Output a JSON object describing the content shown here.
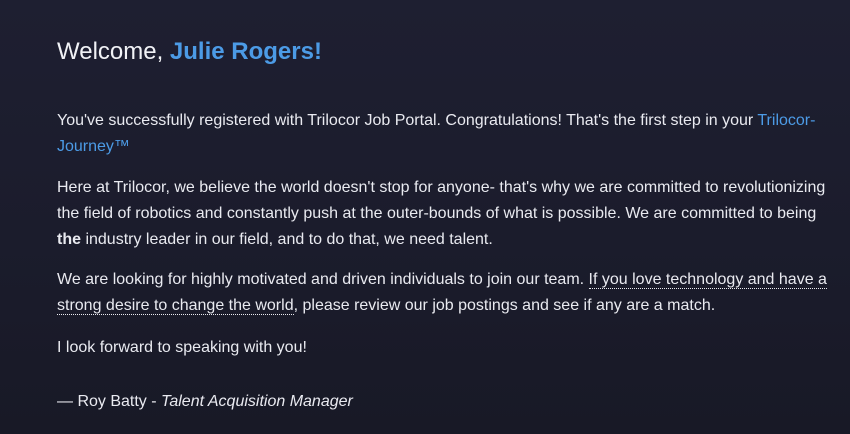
{
  "greeting": {
    "prefix": "Welcome, ",
    "name": "Julie Rogers!"
  },
  "para1": {
    "text": "You've successfully registered with Trilocor Job Portal. Congratulations! That's the first step in your ",
    "link": "Trilocor-Journey™"
  },
  "para2": {
    "before": "Here at Trilocor, we believe the world doesn't stop for anyone- that's why we are committed to revolutionizing the field of robotics and constantly push at the outer-bounds of what is possible. We are committed to being ",
    "bold": "the",
    "after": " industry leader in our field, and to do that, we need talent."
  },
  "para3": {
    "before": "We are looking for highly motivated and driven individuals to join our team. ",
    "dotted": "If you love technology and have a strong desire to change the world",
    "after": ", please review our job postings and see if any are a match."
  },
  "para4": "I look forward to speaking with you!",
  "signature": {
    "name": "— Roy Batty - ",
    "title": "Talent Acquisition Manager"
  },
  "colors": {
    "accent": "#4c9be6",
    "background": "#1e1f31",
    "text": "#e9eaf0"
  }
}
